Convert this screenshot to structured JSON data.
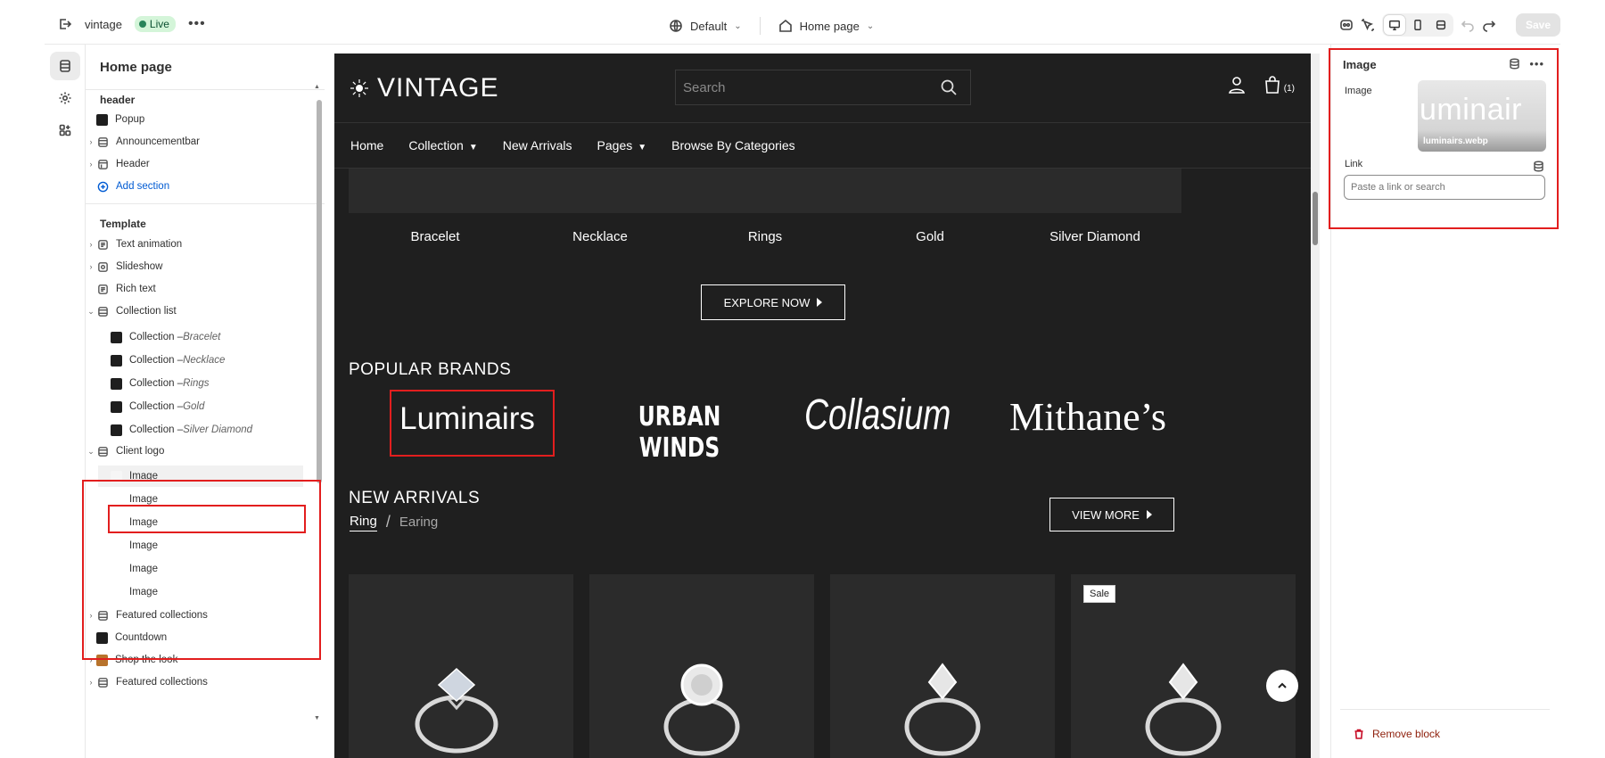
{
  "topbar": {
    "store_name": "vintage",
    "status": "Live",
    "theme": "Default",
    "page": "Home page",
    "save_label": "Save"
  },
  "sidebar": {
    "title": "Home page",
    "header_group": "header",
    "header_items": [
      "Popup",
      "Announcementbar",
      "Header"
    ],
    "add_section": "Add section",
    "template_group": "Template",
    "template_items": [
      "Text animation",
      "Slideshow",
      "Rich text",
      "Collection list"
    ],
    "collection_children": [
      {
        "prefix": "Collection – ",
        "name": "Bracelet"
      },
      {
        "prefix": "Collection – ",
        "name": "Necklace"
      },
      {
        "prefix": "Collection – ",
        "name": "Rings"
      },
      {
        "prefix": "Collection – ",
        "name": "Gold"
      },
      {
        "prefix": "Collection – ",
        "name": "Silver Diamond"
      }
    ],
    "client_logo": "Client logo",
    "client_logo_children": [
      "Image",
      "Image",
      "Image",
      "Image",
      "Image",
      "Image"
    ],
    "after_items": [
      "Featured collections",
      "Countdown",
      "Shop the look",
      "Featured collections"
    ]
  },
  "preview": {
    "logo": "VINTAGE",
    "search_placeholder": "Search",
    "cart_count": "(1)",
    "nav": [
      "Home",
      "Collection",
      "New Arrivals",
      "Pages",
      "Browse By Categories"
    ],
    "collections": [
      "Bracelet",
      "Necklace",
      "Rings",
      "Gold",
      "Silver Diamond"
    ],
    "explore_label": "EXPLORE NOW",
    "popular_brands_title": "POPULAR BRANDS",
    "brands": [
      "Luminairs",
      "URBAN WINDS",
      "Collasium",
      "Mithane’s"
    ],
    "new_arrivals_title": "NEW ARRIVALS",
    "tab_active": "Ring",
    "tab_inactive": "Earing",
    "view_more_label": "VIEW MORE",
    "sale_badge": "Sale"
  },
  "panel": {
    "title": "Image",
    "image_label": "Image",
    "image_overlay_text": "uminair",
    "image_filename": "luminairs.webp",
    "link_label": "Link",
    "link_placeholder": "Paste a link or search",
    "remove_label": "Remove block"
  },
  "colors": {
    "highlight": "#e21e1e",
    "preview_bg": "#1f1f1f",
    "live_badge": "#d4f5d9",
    "remove": "#c70a24"
  }
}
